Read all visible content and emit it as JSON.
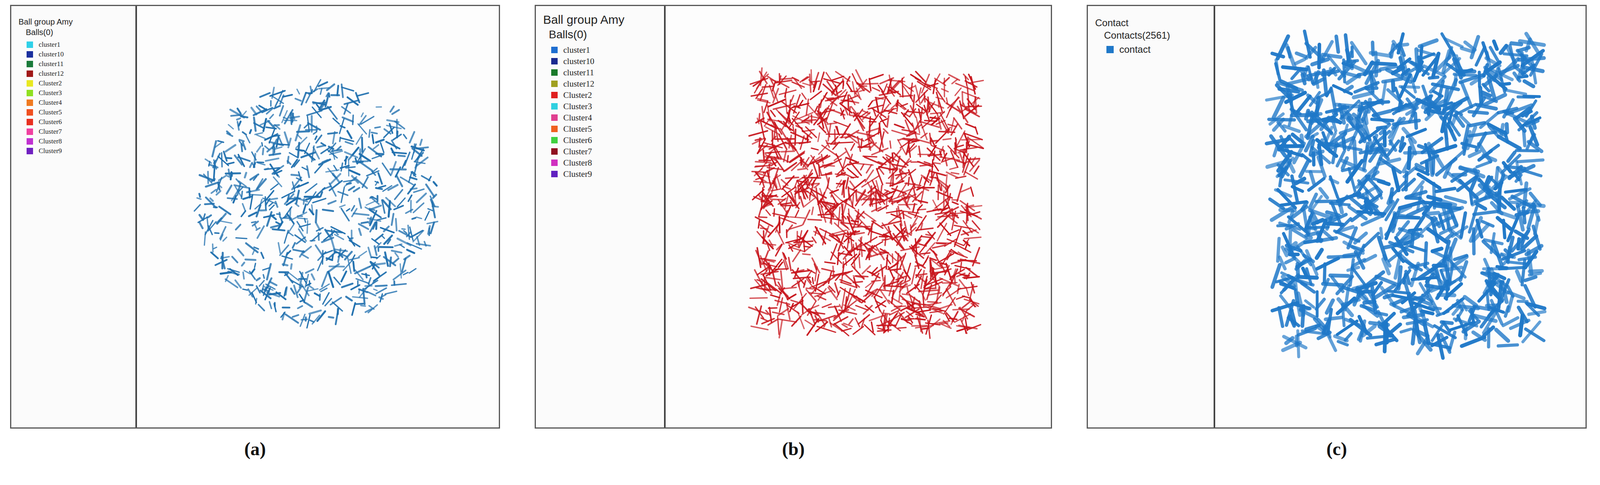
{
  "figure": {
    "panels": [
      {
        "caption": "(a)",
        "header": {
          "title": "Ball group Amy",
          "subtitle": "Balls(0)"
        },
        "legend": [
          {
            "label": "cluster1",
            "color": "#2fd0e8"
          },
          {
            "label": "cluster10",
            "color": "#1a2f9e"
          },
          {
            "label": "cluster11",
            "color": "#1a7a3a"
          },
          {
            "label": "cluster12",
            "color": "#a01818"
          },
          {
            "label": "Cluster2",
            "color": "#e8e820"
          },
          {
            "label": "Cluster3",
            "color": "#90e020"
          },
          {
            "label": "Cluster4",
            "color": "#f07a20"
          },
          {
            "label": "Cluster5",
            "color": "#f05020"
          },
          {
            "label": "Cluster6",
            "color": "#e83020"
          },
          {
            "label": "Cluster7",
            "color": "#f040a0"
          },
          {
            "label": "Cluster8",
            "color": "#c030d0"
          },
          {
            "label": "Cluster9",
            "color": "#7020c0"
          }
        ],
        "particles": {
          "shape": "disc",
          "color": "#1f6fae"
        }
      },
      {
        "caption": "(b)",
        "header": {
          "title": "Ball group Amy",
          "subtitle": "Balls(0)"
        },
        "legend": [
          {
            "label": "cluster1",
            "color": "#1e6ed0"
          },
          {
            "label": "cluster10",
            "color": "#1a2a90"
          },
          {
            "label": "cluster11",
            "color": "#1a7a2a"
          },
          {
            "label": "cluster12",
            "color": "#a0a020"
          },
          {
            "label": "Cluster2",
            "color": "#e02020"
          },
          {
            "label": "Cluster3",
            "color": "#30d0e0"
          },
          {
            "label": "Cluster4",
            "color": "#e04090"
          },
          {
            "label": "Cluster5",
            "color": "#f06020"
          },
          {
            "label": "Cluster6",
            "color": "#40d040"
          },
          {
            "label": "Cluster7",
            "color": "#901020"
          },
          {
            "label": "Cluster8",
            "color": "#d030c0"
          },
          {
            "label": "Cluster9",
            "color": "#6020c0"
          }
        ],
        "particles": {
          "shape": "rectangle",
          "color": "#c8161d"
        }
      },
      {
        "caption": "(c)",
        "header": {
          "title": "Contact",
          "subtitle": "Contacts(2561)"
        },
        "legend": [
          {
            "label": "contact",
            "color": "#1f78c8"
          }
        ],
        "particles": {
          "shape": "tall-rectangle",
          "color": "#1f78c8"
        }
      }
    ]
  }
}
